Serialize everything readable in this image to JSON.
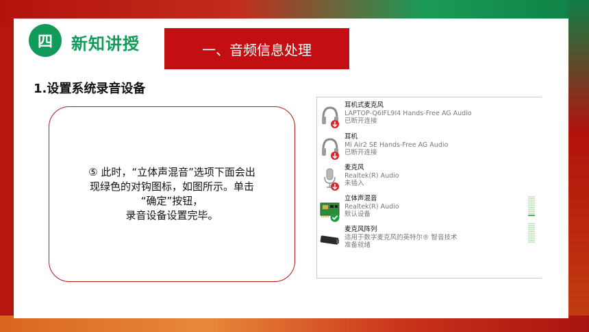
{
  "header": {
    "badge": "四",
    "section_title": "新知讲授",
    "banner": "一、音频信息处理"
  },
  "heading": "1.设置系统录音设备",
  "note": "⑤ 此时，“立体声混音”选项下面会出\n现绿色的对钩图标，如图所示。单击\n“确定”按钮，\n录音设备设置完毕。",
  "devices": [
    {
      "name": "耳机式麦克风",
      "desc": "LAPTOP-Q6IFL9I4 Hands-Free AG Audio",
      "status": "已断开连接",
      "icon": "headset-icon",
      "badge": "red-down-arrow-badge"
    },
    {
      "name": "耳机",
      "desc": "Mi Air2 SE Hands-Free AG Audio",
      "status": "已断开连接",
      "icon": "headset-icon",
      "badge": "red-down-arrow-badge"
    },
    {
      "name": "麦克风",
      "desc": "Realtek(R) Audio",
      "status": "未插入",
      "icon": "microphone-icon",
      "badge": "red-down-arrow-badge"
    },
    {
      "name": "立体声混音",
      "desc": "Realtek(R) Audio",
      "status": "默认设备",
      "icon": "sound-card-icon",
      "badge": "green-check-badge"
    },
    {
      "name": "麦克风阵列",
      "desc": "适用于数字麦克风的英特尔® 智音技术",
      "status": "准备就绪",
      "icon": "microphone-array-icon",
      "badge": ""
    }
  ],
  "colors": {
    "green": "#129a58",
    "red": "#c40f12",
    "border_red": "#b8141a"
  }
}
